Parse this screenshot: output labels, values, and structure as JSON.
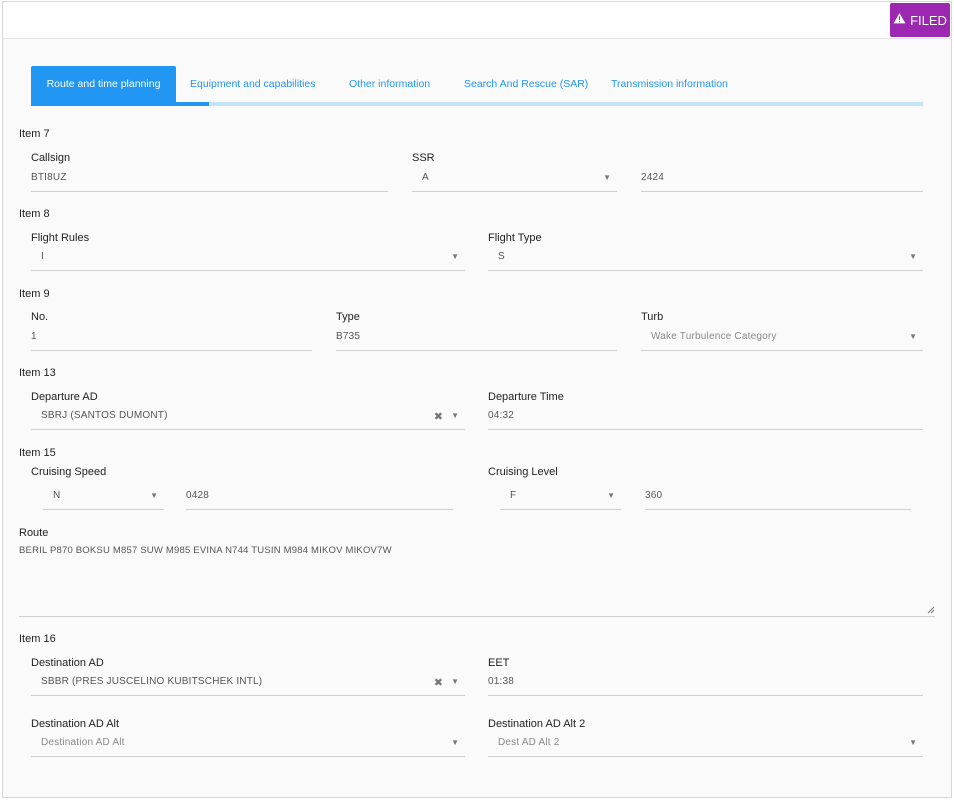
{
  "header": {
    "status_label": "FILED",
    "status_color": "#9c27b0",
    "status_icon": "warning-icon"
  },
  "tabs": [
    {
      "label": "Route and time planning",
      "active": true
    },
    {
      "label": "Equipment and capabilities",
      "active": false
    },
    {
      "label": "Other information",
      "active": false
    },
    {
      "label": "Search And Rescue (SAR)",
      "active": false
    },
    {
      "label": "Transmission information",
      "active": false
    }
  ],
  "item7": {
    "title": "Item 7",
    "callsign": {
      "label": "Callsign",
      "value": "BTI8UZ"
    },
    "ssr": {
      "label": "SSR",
      "mode": "A",
      "code": "2424"
    }
  },
  "item8": {
    "title": "Item 8",
    "flight_rules": {
      "label": "Flight Rules",
      "value": "I"
    },
    "flight_type": {
      "label": "Flight Type",
      "value": "S"
    }
  },
  "item9": {
    "title": "Item 9",
    "number": {
      "label": "No.",
      "value": "1"
    },
    "type": {
      "label": "Type",
      "value": "B735"
    },
    "turb": {
      "label": "Turb",
      "placeholder": "Wake Turbulence Category"
    }
  },
  "item13": {
    "title": "Item 13",
    "departure_ad": {
      "label": "Departure AD",
      "value": "SBRJ (SANTOS DUMONT)"
    },
    "departure_time": {
      "label": "Departure Time",
      "value": "04:32"
    }
  },
  "item15": {
    "title": "Item 15",
    "cruising_speed": {
      "label": "Cruising Speed",
      "unit": "N",
      "value": "0428"
    },
    "cruising_level": {
      "label": "Cruising Level",
      "unit": "F",
      "value": "360"
    },
    "route": {
      "label": "Route",
      "value": "BERIL P870 BOKSU M857 SUW M985 EVINA N744 TUSIN M984 MIKOV MIKOV7W"
    }
  },
  "item16": {
    "title": "Item 16",
    "destination_ad": {
      "label": "Destination AD",
      "value": "SBBR (PRES JUSCELINO KUBITSCHEK INTL)"
    },
    "eet": {
      "label": "EET",
      "value": "01:38"
    },
    "destination_alt": {
      "label": "Destination AD Alt",
      "placeholder": "Destination AD Alt"
    },
    "destination_alt2": {
      "label": "Destination AD Alt 2",
      "placeholder": "Dest AD Alt 2"
    }
  }
}
